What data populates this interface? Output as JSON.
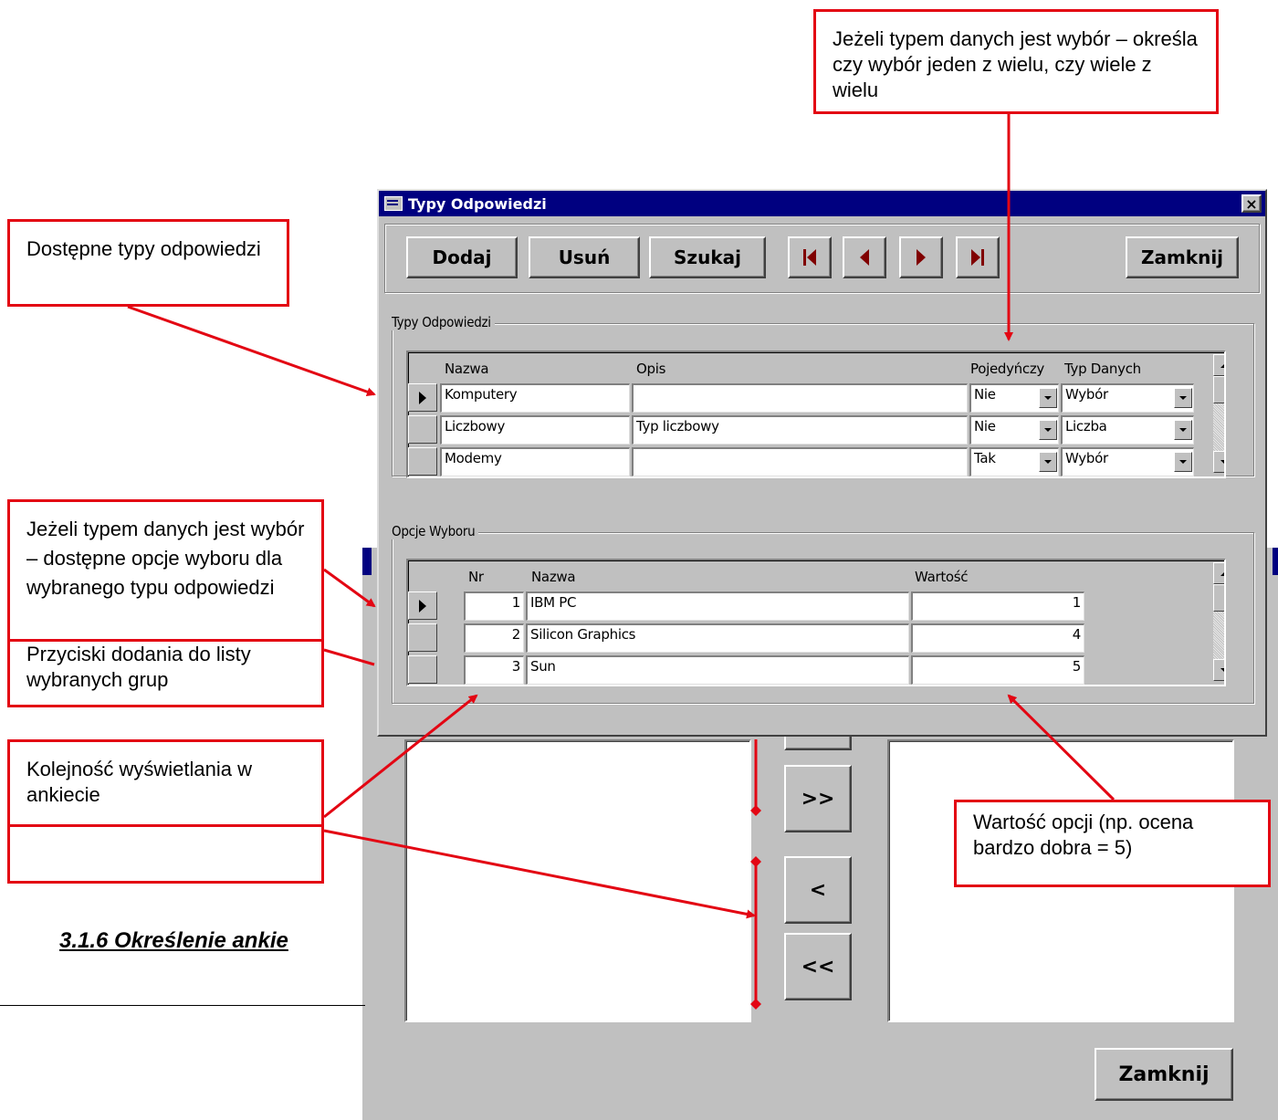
{
  "dialog": {
    "title": "Typy Odpowiedzi",
    "close_label": "×",
    "toolbar": {
      "add_label": "Dodaj",
      "delete_label": "Usuń",
      "search_label": "Szukaj",
      "close_label": "Zamknij",
      "nav_icons": [
        "first-record-icon",
        "previous-record-icon",
        "next-record-icon",
        "last-record-icon"
      ]
    },
    "types_group": {
      "label": "Typy Odpowiedzi",
      "columns": [
        "Nazwa",
        "Opis",
        "Pojedyńczy",
        "Typ Danych"
      ],
      "rows": [
        {
          "nazwa": "Komputery",
          "opis": "",
          "pojedynczy": "Nie",
          "typ_danych": "Wybór",
          "current": true
        },
        {
          "nazwa": "Liczbowy",
          "opis": "Typ liczbowy",
          "pojedynczy": "Nie",
          "typ_danych": "Liczba",
          "current": false
        },
        {
          "nazwa": "Modemy",
          "opis": "",
          "pojedynczy": "Tak",
          "typ_danych": "Wybór",
          "current": false
        }
      ]
    },
    "options_group": {
      "label": "Opcje Wyboru",
      "columns": [
        "Nr",
        "Nazwa",
        "Wartość"
      ],
      "rows": [
        {
          "nr": "1",
          "nazwa": "IBM PC",
          "wartosc": "1",
          "current": true
        },
        {
          "nr": "2",
          "nazwa": "Silicon Graphics",
          "wartosc": "4",
          "current": false
        },
        {
          "nr": "3",
          "nazwa": "Sun",
          "wartosc": "5",
          "current": false
        }
      ]
    }
  },
  "background_window": {
    "move_all_label": ">>",
    "remove_one_label": "<",
    "remove_all_label": "<<",
    "close_label": "Zamknij"
  },
  "annotations": {
    "choice_mode": "Jeżeli typem danych jest wybór – określa czy wybór jeden z wielu, czy wiele z wielu",
    "available_types": "Dostępne typy odpowiedzi",
    "choice_options": "Jeżeli typem danych jest wybór – dostępne opcje wyboru dla wybranego typu odpowiedzi",
    "add_buttons_hidden": "Przyciski dodania do listy wybranych grup",
    "display_order": "Kolejność wyświetlania w ankiecie",
    "option_value": "Wartość opcji (np. ocena bardzo dobra = 5)"
  },
  "heading": "3.1.6 Określenie ankie",
  "colors": {
    "annotation": "#e30613",
    "titlebar": "#000080",
    "face": "#c0c0c0",
    "nav_arrow": "#800000"
  }
}
